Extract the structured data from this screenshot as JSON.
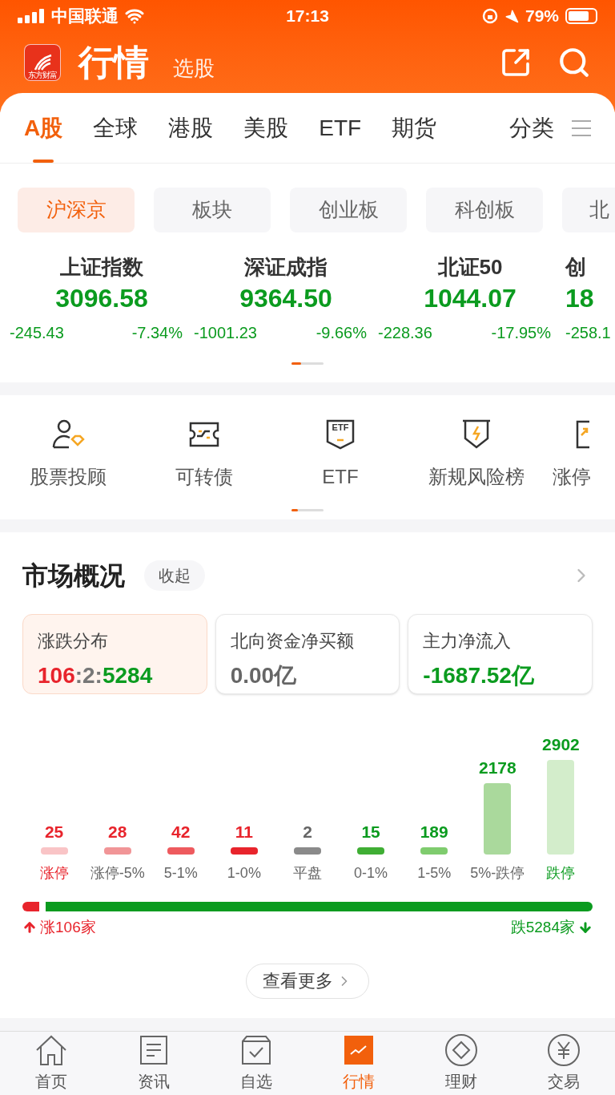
{
  "status_bar": {
    "carrier": "中国联通",
    "time": "17:13",
    "battery": "79%"
  },
  "header": {
    "logo_text": "东方财富",
    "title": "行情",
    "subtitle": "选股"
  },
  "tabs": [
    {
      "label": "A股",
      "selected": true
    },
    {
      "label": "全球",
      "selected": false
    },
    {
      "label": "港股",
      "selected": false
    },
    {
      "label": "美股",
      "selected": false
    },
    {
      "label": "ETF",
      "selected": false
    },
    {
      "label": "期货",
      "selected": false
    }
  ],
  "category_tab": {
    "label": "分类"
  },
  "segments": [
    {
      "label": "沪深京",
      "selected": true
    },
    {
      "label": "板块",
      "selected": false
    },
    {
      "label": "创业板",
      "selected": false
    },
    {
      "label": "科创板",
      "selected": false
    },
    {
      "label": "北",
      "selected": false
    }
  ],
  "indices": [
    {
      "name": "上证指数",
      "value": "3096.58",
      "change": "-245.43",
      "percent": "-7.34%",
      "color": "#0b9b1f"
    },
    {
      "name": "深证成指",
      "value": "9364.50",
      "change": "-1001.23",
      "percent": "-9.66%",
      "color": "#0b9b1f"
    },
    {
      "name": "北证50",
      "value": "1044.07",
      "change": "-228.36",
      "percent": "-17.95%",
      "color": "#0b9b1f"
    },
    {
      "name": "创",
      "value": "18",
      "change": "-258.1",
      "color": "#0b9b1f"
    }
  ],
  "shortcuts": [
    {
      "kind": "advisor",
      "label": "股票投顾"
    },
    {
      "kind": "bond",
      "label": "可转债"
    },
    {
      "kind": "etf",
      "label": "ETF",
      "icon_text": "ETF"
    },
    {
      "kind": "risk",
      "label": "新规风险榜"
    },
    {
      "kind": "limit",
      "label": "涨停"
    }
  ],
  "market": {
    "title": "市场概况",
    "toggle": "收起",
    "cards": [
      {
        "title": "涨跌分布",
        "selected": true,
        "parts": [
          {
            "text": "106",
            "color": "#e8242c"
          },
          {
            "text": ":2:",
            "color": "#777777"
          },
          {
            "text": "5284",
            "color": "#0b9b1f"
          }
        ]
      },
      {
        "title": "北向资金净买额",
        "selected": false,
        "parts": [
          {
            "text": "0.00",
            "color": "#666666"
          },
          {
            "text": "亿",
            "color": "#666666"
          }
        ]
      },
      {
        "title": "主力净流入",
        "selected": false,
        "parts": [
          {
            "text": "-1687.52",
            "color": "#0b9b1f"
          },
          {
            "text": "亿",
            "color": "#0b9b1f"
          }
        ]
      }
    ],
    "distribution": [
      {
        "label": {
          "text": "涨停",
          "color": "#e8242c"
        },
        "count": {
          "text": "25",
          "color": "#e8242c"
        },
        "color": "#f9c4c6"
      },
      {
        "label": {
          "text": "涨停-5%",
          "color": "#666666"
        },
        "count": {
          "text": "28",
          "color": "#e8242c"
        },
        "color": "#f19597"
      },
      {
        "label": {
          "text": "5-1%",
          "color": "#666666"
        },
        "count": {
          "text": "42",
          "color": "#e8242c"
        },
        "color": "#ee5a5e"
      },
      {
        "label": {
          "text": "1-0%",
          "color": "#666666"
        },
        "count": {
          "text": "11",
          "color": "#e8242c"
        },
        "color": "#e8242c"
      },
      {
        "label": {
          "text": "平盘",
          "color": "#666666"
        },
        "count": {
          "text": "2",
          "color": "#666666"
        },
        "color": "#8a8a8a"
      },
      {
        "label": {
          "text": "0-1%",
          "color": "#666666"
        },
        "count": {
          "text": "15",
          "color": "#0b9b1f"
        },
        "color": "#3fae34"
      },
      {
        "label": {
          "text": "1-5%",
          "color": "#666666"
        },
        "count": {
          "text": "189",
          "color": "#0b9b1f"
        },
        "color": "#7fcc6e"
      },
      {
        "label": {
          "text": "5%-跌停",
          "color": "#666666"
        },
        "count": {
          "text": "2178",
          "color": "#0b9b1f"
        },
        "color": "#aad99c"
      },
      {
        "label": {
          "text": "跌停",
          "color": "#0b9b1f"
        },
        "count": {
          "text": "2902",
          "color": "#0b9b1f"
        },
        "color": "#d3edcb"
      }
    ],
    "ratio": {
      "level": 0.03,
      "up_label": "涨106家",
      "down_label": "跌5284家"
    },
    "more_button": "查看更多"
  },
  "bottom_nav": [
    {
      "kind": "home",
      "label": "首页",
      "selected": false
    },
    {
      "kind": "news",
      "label": "资讯",
      "selected": false
    },
    {
      "kind": "watch",
      "label": "自选",
      "selected": false
    },
    {
      "kind": "market",
      "label": "行情",
      "selected": true
    },
    {
      "kind": "wealth",
      "label": "理财",
      "selected": false
    },
    {
      "kind": "trade",
      "label": "交易",
      "selected": false
    }
  ]
}
